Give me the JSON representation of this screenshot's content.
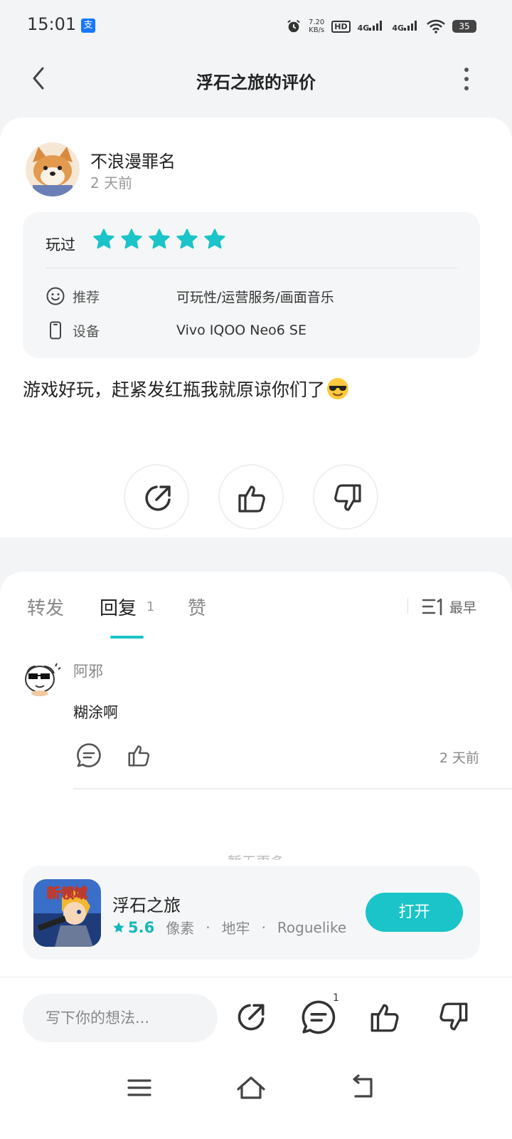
{
  "status_bar": {
    "time": "15:01",
    "alipay_glyph": "支",
    "speed_value": "7.20",
    "speed_unit": "KB/s",
    "hd": "HD",
    "network_1": "4G",
    "network_2": "4G",
    "battery": "35",
    "icons": [
      "alarm-icon",
      "hd-icon",
      "signal-icon",
      "signal-icon",
      "wifi-icon",
      "battery-icon"
    ]
  },
  "header": {
    "title": "浮石之旅的评价",
    "back_icon": "chevron-left-icon",
    "more_icon": "more-vertical-icon"
  },
  "review": {
    "user_name": "不浪漫罪名",
    "time": "2 天前",
    "played_label": "玩过",
    "rating_stars": 5,
    "recommend_label": "推荐",
    "recommend_value": "可玩性/运营服务/画面音乐",
    "device_label": "设备",
    "device_value": "Vivo IQOO Neo6 SE",
    "text": "游戏好玩，赶紧发红瓶我就原谅你们了",
    "emoji": "sunglasses-emoji",
    "accent_color": "#1ac4c8"
  },
  "tabs": [
    {
      "label": "转发"
    },
    {
      "label": "回复",
      "count": "1"
    },
    {
      "label": "赞"
    }
  ],
  "sort": {
    "label": "最早",
    "icon": "sort-list-icon"
  },
  "replies": [
    {
      "user": "阿邪",
      "text": "糊涂啊",
      "time": "2 天前"
    }
  ],
  "no_more": "暂无更多",
  "game": {
    "icon_text": "新领域",
    "name": "浮石之旅",
    "rating": "5.6",
    "tags": [
      "像素",
      "地牢",
      "Roguelike"
    ],
    "separator": "·",
    "open_label": "打开"
  },
  "bottom_bar": {
    "placeholder": "写下你的想法...",
    "comment_count": "1"
  }
}
